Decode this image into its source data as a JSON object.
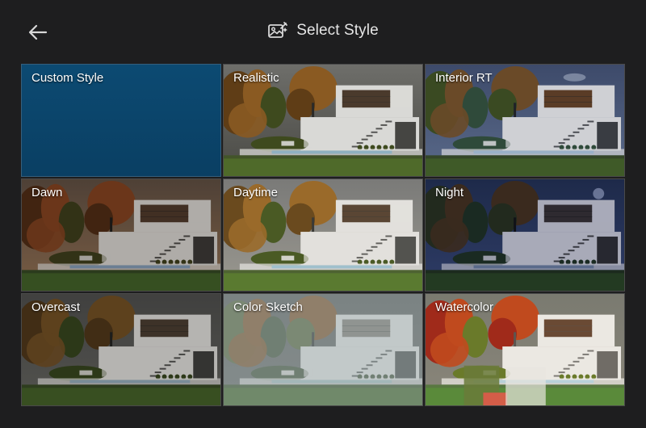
{
  "header": {
    "title": "Select Style",
    "back_icon": "arrow-left-icon",
    "title_icon": "image-edit-icon"
  },
  "styles": [
    {
      "label": "Custom Style"
    },
    {
      "label": "Realistic"
    },
    {
      "label": "Interior RT"
    },
    {
      "label": "Dawn"
    },
    {
      "label": "Daytime"
    },
    {
      "label": "Night"
    },
    {
      "label": "Overcast"
    },
    {
      "label": "Color Sketch"
    },
    {
      "label": "Watercolor"
    }
  ],
  "colors": {
    "background": "#1e1e1f",
    "custom_tile": "#0c4a72"
  }
}
